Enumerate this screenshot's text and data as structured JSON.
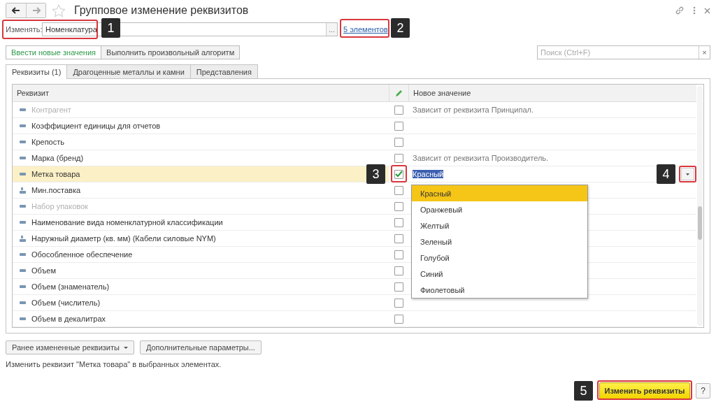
{
  "window": {
    "title": "Групповое изменение реквизитов"
  },
  "change_field": {
    "label": "Изменять:",
    "value": "Номенклатура",
    "button": "...",
    "callout": "1"
  },
  "elements_link": {
    "text": "5 элементов",
    "callout": "2"
  },
  "mode_buttons": [
    {
      "label": "Ввести новые значения",
      "selected": true
    },
    {
      "label": "Выполнить произвольный алгоритм",
      "selected": false
    }
  ],
  "search": {
    "placeholder": "Поиск (Ctrl+F)",
    "clear": "×"
  },
  "tabs": [
    {
      "label": "Реквизиты (1)",
      "selected": true
    },
    {
      "label": "Драгоценные металлы и камни",
      "selected": false
    },
    {
      "label": "Представления",
      "selected": false
    }
  ],
  "table": {
    "columns": [
      "Реквизит",
      "Новое значение"
    ],
    "rows": [
      {
        "name": "Контрагент",
        "kind": "field",
        "disabled": true,
        "checked": false,
        "selected": false,
        "value": "Зависит от реквизита Принципал."
      },
      {
        "name": "Коэффициент единицы для отчетов",
        "kind": "field",
        "disabled": false,
        "checked": false,
        "selected": false
      },
      {
        "name": "Крепость",
        "kind": "field",
        "disabled": false,
        "checked": false,
        "selected": false
      },
      {
        "name": "Марка (бренд)",
        "kind": "field",
        "disabled": false,
        "checked": false,
        "selected": false,
        "value": "Зависит от реквизита Производитель."
      },
      {
        "name": "Метка товара",
        "kind": "field",
        "disabled": false,
        "checked": true,
        "selected": true,
        "value": "Красный",
        "check_callout": "3",
        "button_callout": "4",
        "options": [
          {
            "label": "Красный",
            "selected": true
          },
          {
            "label": "Оранжевый",
            "selected": false
          },
          {
            "label": "Желтый",
            "selected": false
          },
          {
            "label": "Зеленый",
            "selected": false
          },
          {
            "label": "Голубой",
            "selected": false
          },
          {
            "label": "Синий",
            "selected": false
          },
          {
            "label": "Фиолетовый",
            "selected": false
          }
        ]
      },
      {
        "name": "Мин.поставка",
        "kind": "measure",
        "disabled": false,
        "checked": false,
        "selected": false
      },
      {
        "name": "Набор упаковок",
        "kind": "field",
        "disabled": true,
        "checked": false,
        "selected": false
      },
      {
        "name": "Наименование вида номенклатурной классификации",
        "kind": "field",
        "disabled": false,
        "checked": false,
        "selected": false
      },
      {
        "name": "Наружный диаметр (кв. мм) (Кабели силовые NYM)",
        "kind": "measure",
        "disabled": false,
        "checked": false,
        "selected": false
      },
      {
        "name": "Обособленное обеспечение",
        "kind": "field",
        "disabled": false,
        "checked": false,
        "selected": false
      },
      {
        "name": "Объем",
        "kind": "field",
        "disabled": false,
        "checked": false,
        "selected": false
      },
      {
        "name": "Объем (знаменатель)",
        "kind": "field",
        "disabled": false,
        "checked": false,
        "selected": false
      },
      {
        "name": "Объем (числитель)",
        "kind": "field",
        "disabled": false,
        "checked": false,
        "selected": false
      },
      {
        "name": "Объем в декалитрах",
        "kind": "field",
        "disabled": false,
        "checked": false,
        "selected": false
      }
    ]
  },
  "bottom_buttons": [
    {
      "label": "Ранее измененные реквизиты",
      "dropdown": true
    },
    {
      "label": "Дополнительные параметры...",
      "dropdown": false
    }
  ],
  "hint": "Изменить реквизит \"Метка товара\" в выбранных элементах.",
  "apply_button": {
    "label": "Изменить реквизиты",
    "callout": "5"
  },
  "help_button": {
    "label": "?"
  }
}
